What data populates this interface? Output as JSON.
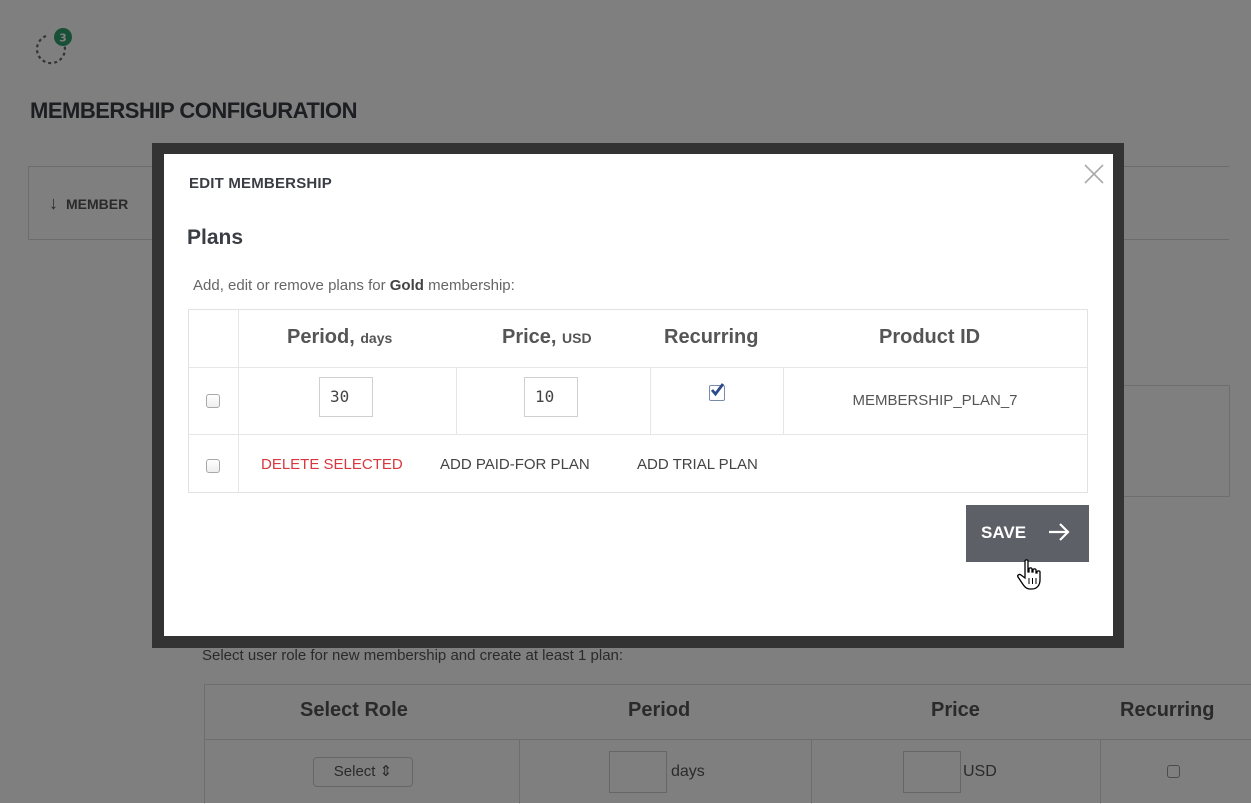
{
  "background": {
    "page_title": "MEMBERSHIP CONFIGURATION",
    "notification_count": "3",
    "tab_label": "MEMBER",
    "instructions": "Select user role for new membership and create at least 1 plan:",
    "table": {
      "headers": [
        "Select Role",
        "Period",
        "Price",
        "Recurring"
      ],
      "select_value": "Select",
      "period_unit": "days",
      "price_unit": "USD"
    }
  },
  "modal": {
    "title": "EDIT MEMBERSHIP",
    "section_heading": "Plans",
    "description_prefix": "Add, edit or remove plans for ",
    "membership_name": "Gold",
    "description_suffix": " membership:",
    "columns": {
      "period": "Period,",
      "period_unit": "days",
      "price": "Price,",
      "price_unit": "USD",
      "recurring": "Recurring",
      "product_id": "Product ID"
    },
    "rows": [
      {
        "period": "30",
        "price": "10",
        "recurring": true,
        "product_id": "MEMBERSHIP_PLAN_7",
        "selected": false
      }
    ],
    "actions": {
      "delete": "DELETE SELECTED",
      "add_paid": "ADD PAID-FOR PLAN",
      "add_trial": "ADD TRIAL PLAN"
    },
    "save_label": "SAVE"
  },
  "colors": {
    "accent_green": "#2f9e6e",
    "delete_red": "#d9363e",
    "save_button": "#5d6066",
    "checkbox_check": "#2b4a8c"
  }
}
